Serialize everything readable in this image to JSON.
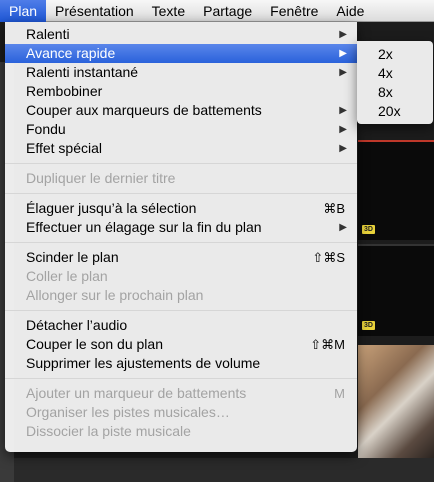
{
  "menubar": {
    "items": [
      "Plan",
      "Présentation",
      "Texte",
      "Partage",
      "Fenêtre",
      "Aide"
    ]
  },
  "menu": {
    "group1": [
      {
        "label": "Ralenti",
        "arrow": "▶"
      },
      {
        "label": "Avance rapide",
        "arrow": "▶"
      },
      {
        "label": "Ralenti instantané",
        "arrow": "▶"
      },
      {
        "label": "Rembobiner"
      },
      {
        "label": "Couper aux marqueurs de battements",
        "arrow": "▶"
      },
      {
        "label": "Fondu",
        "arrow": "▶"
      },
      {
        "label": "Effet spécial",
        "arrow": "▶"
      }
    ],
    "group2": [
      {
        "label": "Dupliquer le dernier titre"
      }
    ],
    "group3": [
      {
        "label": "Élaguer jusqu’à la sélection",
        "shortcut": "⌘B"
      },
      {
        "label": "Effectuer un élagage sur la fin du plan",
        "arrow": "▶"
      }
    ],
    "group4": [
      {
        "label": "Scinder le plan",
        "shortcut": "⇧⌘S"
      },
      {
        "label": "Coller le plan"
      },
      {
        "label": "Allonger sur le prochain plan"
      }
    ],
    "group5": [
      {
        "label": "Détacher l’audio"
      },
      {
        "label": "Couper le son du plan",
        "shortcut": "⇧⌘M"
      },
      {
        "label": "Supprimer les ajustements de volume"
      }
    ],
    "group6": [
      {
        "label": "Ajouter un marqueur de battements",
        "shortcut": "M"
      },
      {
        "label": "Organiser les pistes musicales…"
      },
      {
        "label": "Dissocier la piste musicale"
      }
    ]
  },
  "submenu": {
    "items": [
      "2x",
      "4x",
      "8x",
      "20x"
    ]
  },
  "background": {
    "badge": "3D"
  }
}
